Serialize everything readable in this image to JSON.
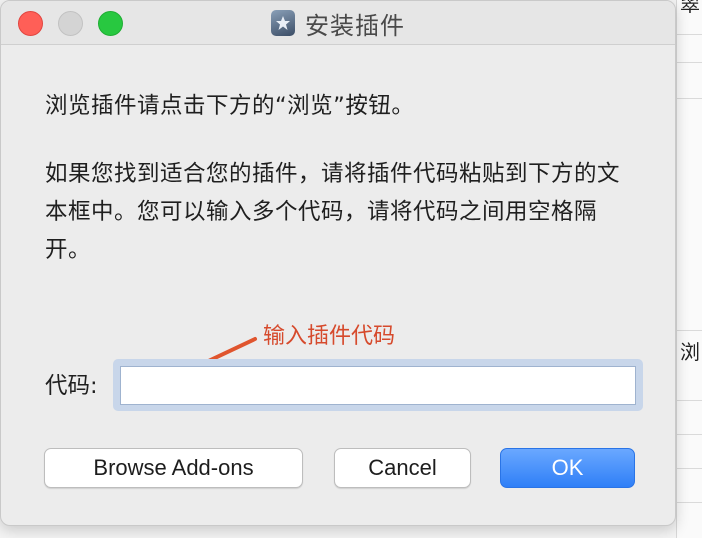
{
  "dialog": {
    "title": "安装插件",
    "app_icon": "puzzle-app-icon",
    "instruction_1": "浏览插件请点击下方的“浏览”按钮。",
    "instruction_2": "如果您找到适合您的插件，请将插件代码粘贴到下方的文本框中。您可以输入多个代码，请将代码之间用空格隔开。",
    "code_label": "代码:",
    "code_value": "",
    "buttons": {
      "browse": "Browse Add-ons",
      "cancel": "Cancel",
      "ok": "OK"
    }
  },
  "annotation": {
    "text": "输入插件代码",
    "color": "#d64a2c"
  },
  "background": {
    "glyph_top": "翠",
    "glyph_mid": "浏"
  },
  "colors": {
    "accent": "#2f7ff7",
    "close": "#ff5f57",
    "maximize": "#28c840"
  }
}
